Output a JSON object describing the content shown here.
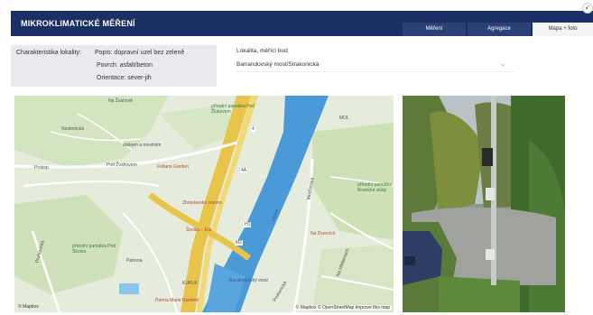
{
  "header": {
    "title": "MIKROKLIMATICKÉ MĚŘENÍ",
    "tabs": [
      {
        "label": "Měření",
        "active": false
      },
      {
        "label": "Agregace",
        "active": false
      },
      {
        "label": "Mapa + foto",
        "active": true
      }
    ]
  },
  "characteristics": {
    "label": "Charakteristika lokality:",
    "rows": [
      {
        "key": "Popis:",
        "value": "dopravní uzel bez zeleně"
      },
      {
        "key": "Povrch:",
        "value": "asfalt/beton"
      },
      {
        "key": "Orientace:",
        "value": "sever-jih"
      }
    ]
  },
  "location": {
    "label": "Lokalita, měřící bod",
    "selected": "Barrandovský most/Strakonická"
  },
  "map": {
    "labels": {
      "na_zvahove": "Na Žvahově",
      "noutonicka": "Noutonická",
      "prirodni_pamatka_zluty": "přírodní památka Pod Žlukovem",
      "mol": "MOL",
      "dobrem_mostisim": "dobrem a mostisim",
      "prokop": "Prokop",
      "pod_zvahovem": "Pod Žvahovem",
      "foltano_garden": "Foltano Garden",
      "zbraslavska_stanice": "Zbraslavská stanice",
      "skolka_erb": "Školka – Erb",
      "vltava": "Vltava",
      "modranska": "Modřanská",
      "prirodni_pamatka_branik": "přírodní památka Branické skály",
      "na_dvorcich": "Na Dvorcích",
      "prirodni_pamatka_skalou": "přírodní památka Pod Školou",
      "patrona": "Patrona",
      "kukuk": "KUKUK",
      "barrandovsky_most": "Barrandovský most",
      "parma_marie": "Parma Marie Baletmé",
      "pruhonicka": "Pruhonická",
      "na_hrebenech": "Na Hřebenech",
      "route_4": "4",
      "route_a4": "4A",
      "route_h1": "H1",
      "route_m2": "M2"
    },
    "mapbox_logo": "© Mapbox",
    "attribution": "© Mapbox © OpenStreetMap Improve this map"
  },
  "colors": {
    "header_bg": "#1a2f63",
    "tab_bg": "#2b4074",
    "char_box_bg": "#e8eaef",
    "river": "#4a9ad8",
    "highway": "#e8c44a",
    "park_green": "#c9dfb2"
  }
}
